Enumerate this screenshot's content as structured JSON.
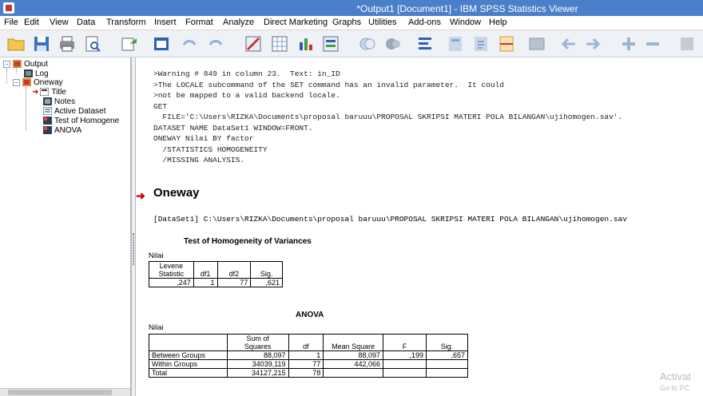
{
  "window": {
    "title": "*Output1 [Document1] - IBM SPSS Statistics Viewer"
  },
  "menu": [
    "File",
    "Edit",
    "View",
    "Data",
    "Transform",
    "Insert",
    "Format",
    "Analyze",
    "Direct Marketing",
    "Graphs",
    "Utilities",
    "Add-ons",
    "Window",
    "Help"
  ],
  "toolbar": {
    "icons": [
      "open-folder-icon",
      "save-icon",
      "print-icon",
      "print-preview-icon",
      "export-icon",
      "recall-dialog-icon",
      "undo-icon",
      "redo-icon",
      "goto-data-icon",
      "goto-case-icon",
      "variables-icon",
      "select-cases-icon",
      "show-all-icon",
      "hide-icon",
      "insert-heading-icon",
      "insert-title-icon",
      "insert-text-icon",
      "insert-page-break-icon",
      "designate-window-icon",
      "back-icon",
      "forward-icon",
      "expand-icon",
      "collapse-icon",
      "show-icon"
    ]
  },
  "nav": {
    "items": [
      {
        "label": "Output"
      },
      {
        "label": "Log"
      },
      {
        "label": "Oneway"
      },
      {
        "label": "Title"
      },
      {
        "label": "Notes"
      },
      {
        "label": "Active Dataset"
      },
      {
        "label": "Test of Homogene"
      },
      {
        "label": "ANOVA"
      }
    ]
  },
  "log": {
    "lines": [
      ">Warning # 849 in column 23.  Text: in_ID",
      ">The LOCALE subcommand of the SET command has an invalid parameter.  It could",
      ">not be mapped to a valid backend locale.",
      "GET",
      "  FILE='C:\\Users\\RIZKA\\Documents\\proposal baruuu\\PROPOSAL SKRIPSI MATERI POLA BILANGAN\\ujihomogen.sav'.",
      "DATASET NAME DataSet1 WINDOW=FRONT.",
      "ONEWAY Nilai BY factor",
      "  /STATISTICS HOMOGENEITY",
      "  /MISSING ANALYSIS."
    ]
  },
  "section": {
    "heading": "Oneway",
    "dataset_line": "[DataSet1] C:\\Users\\RIZKA\\Documents\\proposal baruuu\\PROPOSAL SKRIPSI MATERI POLA BILANGAN\\ujihomogen.sav"
  },
  "homogeneity": {
    "title": "Test of Homogeneity of Variances",
    "caption": "Nilai",
    "headers": [
      "Levene\nStatistic",
      "df1",
      "df2",
      "Sig."
    ],
    "row": [
      ",247",
      "1",
      "77",
      ",621"
    ]
  },
  "anova": {
    "title": "ANOVA",
    "caption": "Nilai",
    "headers": [
      "",
      "Sum of\nSquares",
      "df",
      "Mean Square",
      "F",
      "Sig."
    ],
    "rows": [
      [
        "Between Groups",
        "88,097",
        "1",
        "88,097",
        ",199",
        ",657"
      ],
      [
        "Within Groups",
        "34039,119",
        "77",
        "442,066",
        "",
        ""
      ],
      [
        "Total",
        "34127,215",
        "78",
        "",
        "",
        ""
      ]
    ]
  },
  "watermark": {
    "line1": "Activat",
    "line2": "Go to PC"
  }
}
